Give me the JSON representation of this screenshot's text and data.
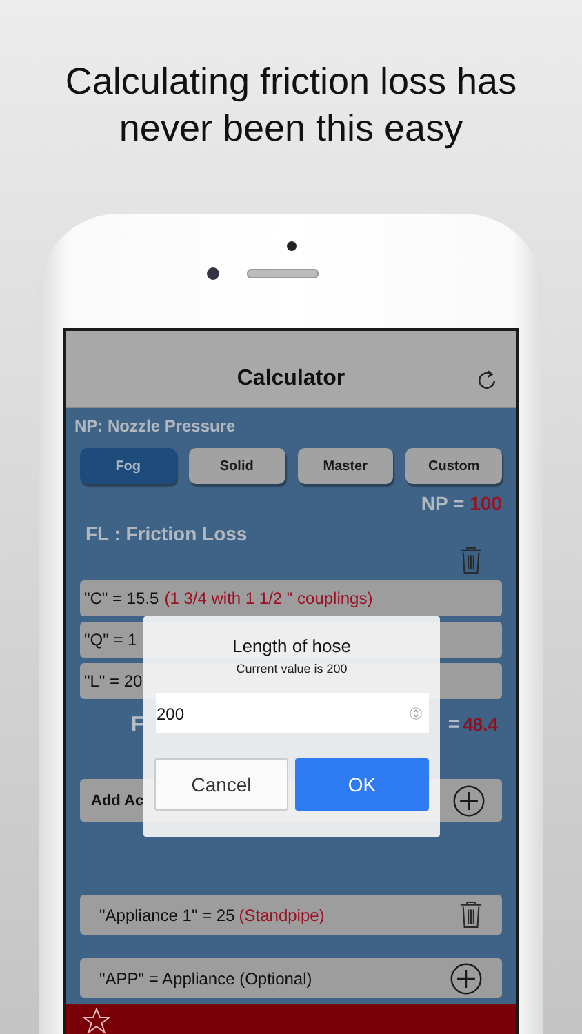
{
  "headline": "Calculating friction loss has never been this easy",
  "nav": {
    "title": "Calculator"
  },
  "nozzle": {
    "heading": "NP: Nozzle Pressure",
    "modes": [
      {
        "label": "Fog",
        "selected": true
      },
      {
        "label": "Solid",
        "selected": false
      },
      {
        "label": "Master",
        "selected": false
      },
      {
        "label": "Custom",
        "selected": false
      }
    ],
    "np_label": "NP =",
    "np_value": "100"
  },
  "friction": {
    "heading": "FL : Friction Loss",
    "rows": [
      {
        "text": "\"C\" = 15.5",
        "note": "(1 3/4 with 1 1/2 \" couplings)"
      },
      {
        "text": "\"Q\" = 1"
      },
      {
        "text": "\"L\" = 20"
      }
    ],
    "result_label": "F",
    "result_equals": "=",
    "result_value": "48.4"
  },
  "add_row": {
    "text": "Add Ac"
  },
  "appliances": [
    {
      "kind": "entry",
      "text": "\"Appliance 1\" = 25",
      "note": "(Standpipe)"
    },
    {
      "kind": "add",
      "text": "\"APP\" = Appliance (Optional)"
    }
  ],
  "dialog": {
    "title": "Length of hose",
    "message": "Current value is 200",
    "value": "200",
    "buttons": [
      {
        "kind": "cancel",
        "label": "Cancel"
      },
      {
        "kind": "primary",
        "label": "OK"
      }
    ]
  }
}
